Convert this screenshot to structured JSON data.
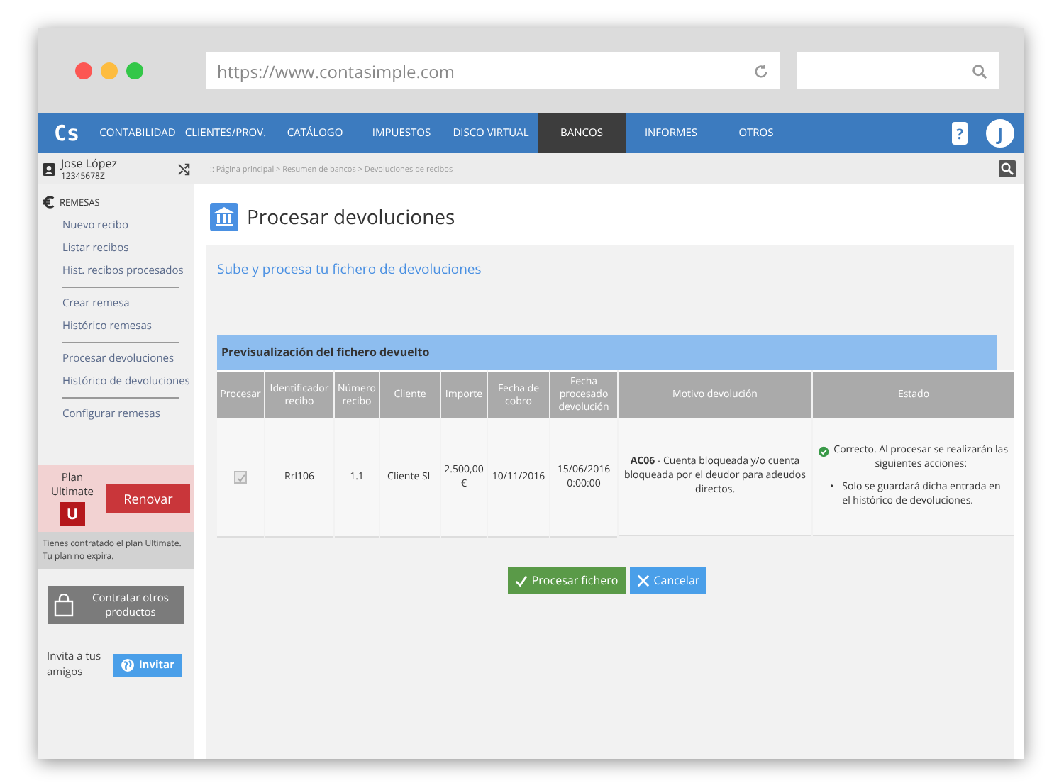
{
  "browser": {
    "url": "https://www.contasimple.com"
  },
  "nav": {
    "logo": "Cs",
    "items": [
      {
        "label": "CONTABILIDAD",
        "selected": false
      },
      {
        "label": "CLIENTES/PROV.",
        "selected": false
      },
      {
        "label": "CATÁLOGO",
        "selected": false
      },
      {
        "label": "IMPUESTOS",
        "selected": false
      },
      {
        "label": "DISCO VIRTUAL",
        "selected": false
      },
      {
        "label": "BANCOS",
        "selected": true
      },
      {
        "label": "INFORMES",
        "selected": false
      },
      {
        "label": "OTROS",
        "selected": false
      }
    ],
    "help": "?",
    "avatar": "J"
  },
  "user": {
    "name": "Jose López",
    "id": "12345678Z"
  },
  "breadcrumb": ":: Página principal > Resumen de bancos > Devoluciones de recibos",
  "sidebar": {
    "section": "REMESAS",
    "groups": [
      [
        "Nuevo recibo",
        "Listar recibos",
        "Hist. recibos procesados"
      ],
      [
        "Crear remesa",
        "Histórico remesas"
      ],
      [
        "Procesar devoluciones",
        "Histórico de devoluciones"
      ],
      [
        "Configurar remesas"
      ]
    ]
  },
  "plan": {
    "label": "Plan",
    "name": "Ultimate",
    "badge": "U",
    "button": "Renovar",
    "note": "Tienes contratado el plan Ultimate. Tu plan no expira."
  },
  "contract_button": "Contratar otros productos",
  "invite": {
    "text": "Invita a tus amigos",
    "button": "Invitar"
  },
  "page": {
    "title": "Procesar devoluciones",
    "subtitle": "Sube y procesa tu fichero de devoluciones"
  },
  "table": {
    "caption": "Previsualización del fichero devuelto",
    "columns": [
      "Procesar",
      "Identificador recibo",
      "Número recibo",
      "Cliente",
      "Importe",
      "Fecha de cobro",
      "Fecha procesado devolución",
      "Motivo devolución",
      "Estado"
    ],
    "rows": [
      {
        "checked": true,
        "disabled": true,
        "id": "Rrl106",
        "number": "1.1",
        "client": "Cliente SL",
        "amount": "2.500,00 €",
        "charge_date": "10/11/2016",
        "processed_date": "15/06/2016 0:00:00",
        "reason": "**AC06** - Cuenta bloqueada y/o cuenta bloqueada por el deudor para adeudos directos.",
        "status": {
          "ok": true,
          "text": "Correcto. Al procesar se realizarán las siguientes acciones:",
          "bullet": "•",
          "actions": [
            "Solo se guardará dicha entrada en el histórico de devoluciones."
          ]
        }
      }
    ]
  },
  "buttons": [
    {
      "kind": "primary",
      "label": "Procesar fichero"
    },
    {
      "kind": "secondary",
      "label": "Cancelar"
    }
  ]
}
